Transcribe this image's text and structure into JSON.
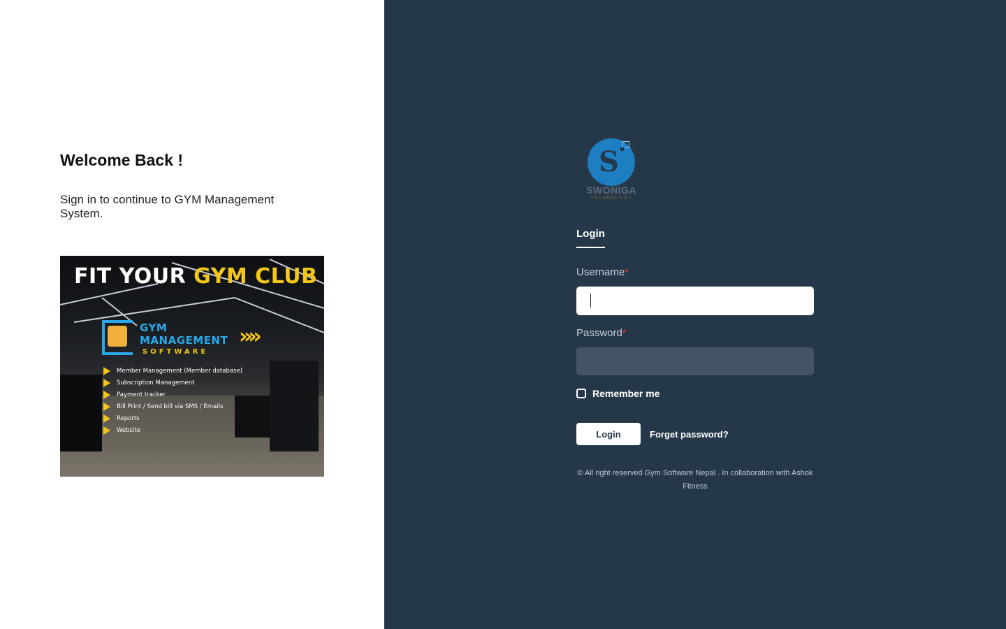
{
  "left": {
    "welcome_title": "Welcome Back !",
    "subtitle": "Sign in to continue to GYM Management System.",
    "promo": {
      "title_white": "FIT YOUR",
      "title_yellow": "GYM CLUB",
      "product_line1": "GYM",
      "product_line2": "MANAGEMENT",
      "product_line3": "SOFTWARE",
      "arrows": "»»",
      "features": [
        "Member Management (Member database)",
        "Subscription Management",
        "Payment tracker",
        "Bill Print / Send bill via SMS / Emails",
        "Reports",
        "Website"
      ]
    }
  },
  "right": {
    "brand": {
      "name": "SWONIGA",
      "sub": "TECHNOLOGY",
      "glyph": "S"
    },
    "tab_label": "Login",
    "username_label": "Username",
    "password_label": "Password",
    "required_mark": "*",
    "username_value": "",
    "password_value": "",
    "remember_label": "Remember me",
    "login_button": "Login",
    "forgot_link": "Forget password?",
    "footer": "© All right reserved Gym Software Nepal . In collaboration with Ashok Fitness"
  },
  "colors": {
    "right_bg": "#25384a",
    "password_bg": "#425466",
    "accent_blue": "#1e7ec2",
    "promo_yellow": "#f3c71a",
    "promo_blue": "#2aa7e8",
    "required_red": "#e53935"
  }
}
